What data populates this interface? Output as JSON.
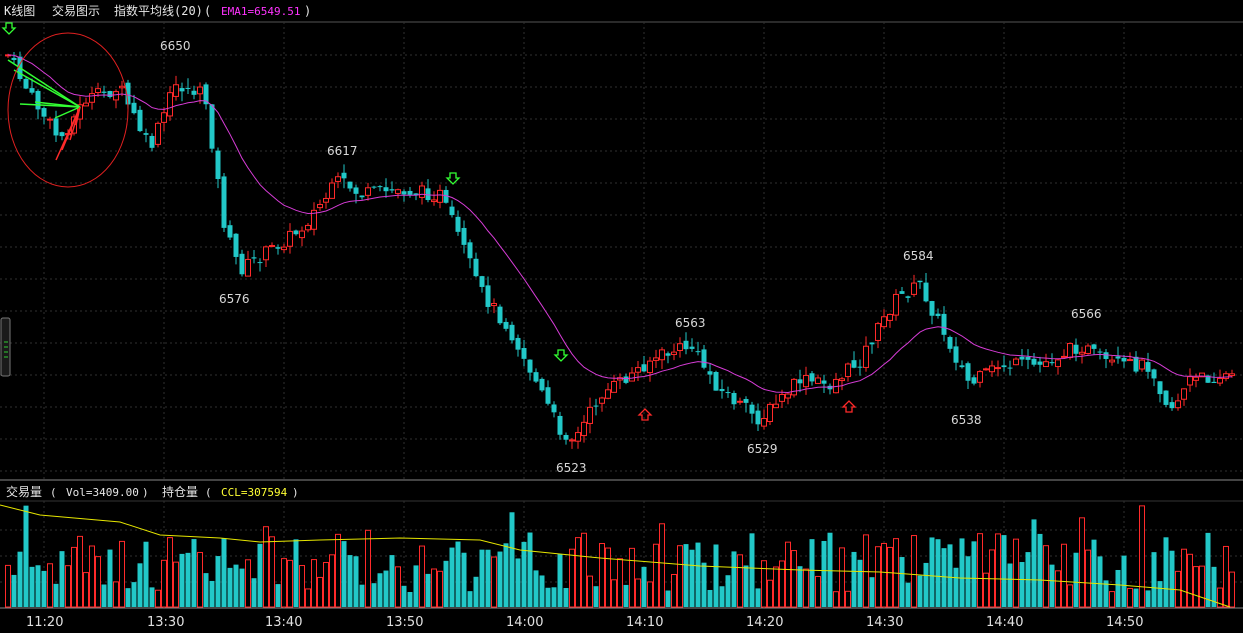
{
  "header": {
    "tab_kline": "K线图",
    "tab_trade": "交易图示",
    "tab_indicator": "指数平均线(20)",
    "paren_open": "(",
    "ema_value": "EMA1=6549.51",
    "paren_close": ")"
  },
  "volume_header": {
    "title": "交易量",
    "paren_open": "(",
    "vol_value": "Vol=3409.00",
    "paren_close": ")",
    "oi_title": "持仓量",
    "oi_paren_open": "(",
    "ccl_value": "CCL=307594",
    "oi_paren_close": ")"
  },
  "colors": {
    "up": "#ff2a2a",
    "down": "#22c8c8",
    "ema": "#d63cd6",
    "ccl": "#e6e600",
    "grid": "#303030",
    "signal": "#33ff33"
  },
  "chart_data": {
    "type": "candlestick",
    "x_ticks": [
      "11:20",
      "13:30",
      "13:40",
      "13:50",
      "14:00",
      "14:10",
      "14:20",
      "14:30",
      "14:40",
      "14:50"
    ],
    "price_annotations": [
      "6650",
      "6617",
      "6576",
      "6584",
      "6563",
      "6523",
      "6529",
      "6538",
      "6566"
    ],
    "grid": true,
    "series": [
      {
        "name": "EMA1",
        "type": "line"
      },
      {
        "name": "Vol",
        "type": "bar"
      },
      {
        "name": "CCL",
        "type": "line"
      }
    ]
  }
}
